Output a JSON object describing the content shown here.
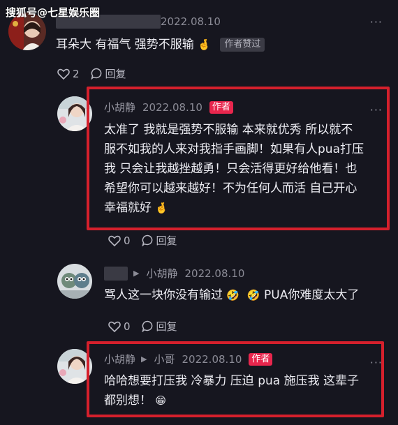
{
  "watermark": "搜狐号@七星娱乐圈",
  "comments": [
    {
      "date": "2022.08.10",
      "text": "耳朵大 有福气 强势不服输",
      "emoji": "🤞",
      "liked_tag": "作者赞过",
      "likes": "2",
      "reply_label": "回复"
    },
    {
      "name": "小胡静",
      "date": "2022.08.10",
      "author_tag": "作者",
      "text_lines": [
        "太准了 我就是强势不服输 本来就优秀 所以就不",
        "服不如我的人来对我指手画脚！如果有人pua打压",
        "我 只会让我越挫越勇！只会活得更好给他看！也",
        "希望你可以越来越好！不为任何人而活 自己开心",
        "幸福就好"
      ],
      "emoji": "🤞",
      "likes": "0",
      "reply_label": "回复"
    },
    {
      "reply_to": "小胡静",
      "date": "2022.08.10",
      "text": "骂人这一块你没有输过",
      "emoji1": "🤣",
      "emoji2": "🤣",
      "text_tail": "PUA你难度太大了",
      "likes": "0",
      "reply_label": "回复"
    },
    {
      "name": "小胡静",
      "reply_to": "小哥",
      "date": "2022.08.10",
      "author_tag": "作者",
      "text_lines": [
        "哈哈想要打压我 冷暴力 压迫 pua 施压我 这辈子",
        "都别想！"
      ],
      "emoji": "😁"
    }
  ],
  "colors": {
    "background": "#16161f",
    "highlight_box": "#d5202c",
    "author_tag": "#e8264d"
  }
}
